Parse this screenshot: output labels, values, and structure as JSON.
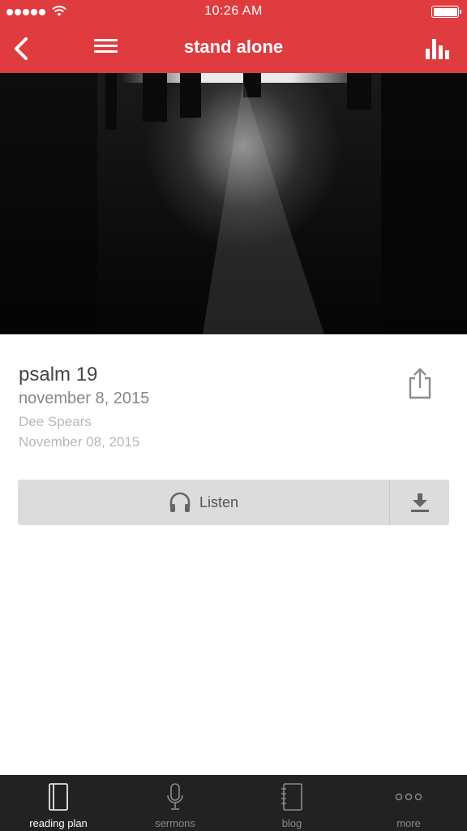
{
  "status_bar": {
    "time": "10:26 AM"
  },
  "nav": {
    "title": "stand alone",
    "icons": [
      "back-icon",
      "menu-icon",
      "stats-icon"
    ]
  },
  "hero": {
    "description_icon": "photo"
  },
  "sermon": {
    "title": "psalm 19",
    "date": "november 8, 2015",
    "speaker": "Dee Spears",
    "published": "November 08, 2015"
  },
  "actions": {
    "listen_label": "Listen",
    "icons": [
      "headphones-icon",
      "download-icon",
      "share-icon"
    ]
  },
  "tabs": [
    {
      "label": "reading plan",
      "icon": "book-icon",
      "active": true
    },
    {
      "label": "sermons",
      "icon": "microphone-icon",
      "active": false
    },
    {
      "label": "blog",
      "icon": "notebook-icon",
      "active": false
    },
    {
      "label": "more",
      "icon": "more-icon",
      "active": false
    }
  ],
  "colors": {
    "accent": "#e03c40",
    "tab_bar": "#222222",
    "button_bg": "#dcdcdc"
  }
}
